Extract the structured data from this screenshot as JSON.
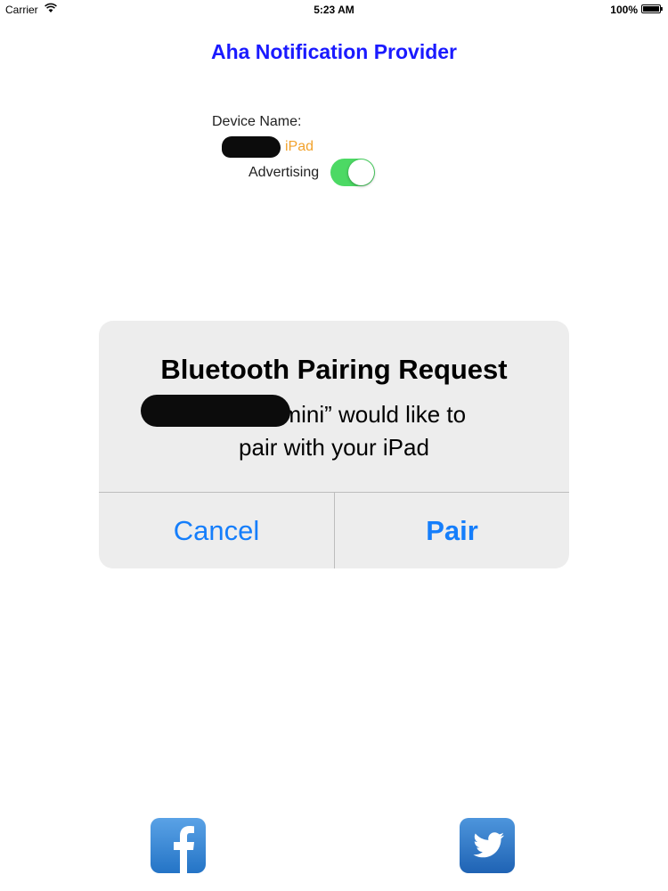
{
  "status_bar": {
    "carrier": "Carrier",
    "time": "5:23 AM",
    "battery": "100%"
  },
  "app": {
    "title": "Aha Notification Provider",
    "device_name_label": "Device Name:",
    "device_name_suffix": "iPad",
    "advertising_label": "Advertising",
    "advertising_on": true
  },
  "alert": {
    "title": "Bluetooth Pairing Request",
    "message_line1": "“E          Mac mini” would like to",
    "message_line2": "pair with your iPad",
    "cancel_label": "Cancel",
    "pair_label": "Pair"
  },
  "social": {
    "facebook_icon": "facebook-icon",
    "twitter_icon": "twitter-icon"
  },
  "colors": {
    "title_blue": "#1a1aff",
    "ipad_orange": "#f2a22c",
    "toggle_green": "#4cd964",
    "ios_blue": "#157efb"
  }
}
